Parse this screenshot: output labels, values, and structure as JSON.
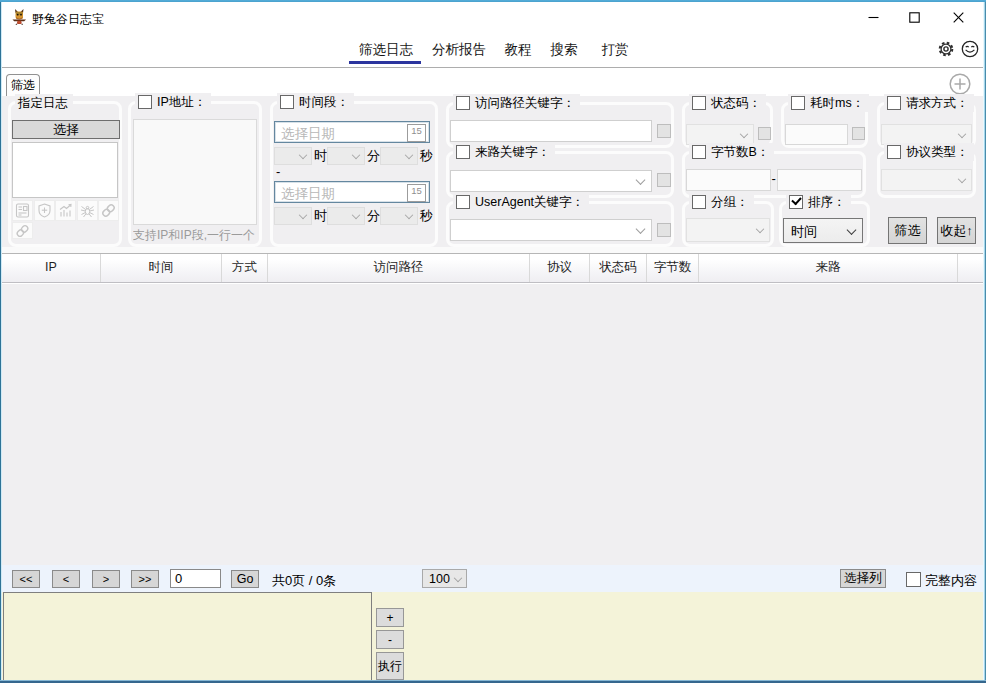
{
  "window": {
    "title": "野兔谷日志宝"
  },
  "menu": {
    "items": [
      {
        "label": "筛选日志"
      },
      {
        "label": "分析报告"
      },
      {
        "label": "教程"
      },
      {
        "label": "搜索"
      },
      {
        "label": "打赏"
      }
    ]
  },
  "tab_strip": {
    "active_tab": "筛选"
  },
  "filter": {
    "specify_log": {
      "title": "指定日志",
      "select_button": "选择"
    },
    "ip_address": {
      "label": "IP地址：",
      "hint": "支持IP和IP段,一行一个"
    },
    "time_range": {
      "label": "时间段：",
      "date_placeholder": "选择日期",
      "calendar_day": "15",
      "hour_label": "时",
      "minute_label": "分",
      "second_label": "秒",
      "range_separator": "-"
    },
    "path_keyword": {
      "label": "访问路径关键字："
    },
    "referer_keyword": {
      "label": "来路关键字："
    },
    "useragent_keyword": {
      "label": "UserAgent关键字："
    },
    "status_code": {
      "label": "状态码："
    },
    "elapsed_ms": {
      "label": "耗时ms："
    },
    "request_method": {
      "label": "请求方式："
    },
    "bytes": {
      "label": "字节数B：",
      "range_separator": "-"
    },
    "protocol_type": {
      "label": "协议类型："
    },
    "group_by": {
      "label": "分组："
    },
    "sort": {
      "label": "排序：",
      "selected": "时间",
      "checked": true
    },
    "filter_button": "筛选",
    "collapse_button": "收起↑"
  },
  "table": {
    "columns": [
      "IP",
      "时间",
      "方式",
      "访问路径",
      "协议",
      "状态码",
      "字节数",
      "来路"
    ]
  },
  "pagination": {
    "first_button": "<<",
    "prev_button": "<",
    "next_button": ">",
    "last_button": ">>",
    "page_input": "0",
    "go_button": "Go",
    "summary": "共0页 / 0条",
    "page_size": "100",
    "select_columns_button": "选择列",
    "full_content_label": "完整内容"
  },
  "bottom_panel": {
    "zoom_in_button": "+",
    "zoom_out_button": "-",
    "execute_button": "执行"
  }
}
